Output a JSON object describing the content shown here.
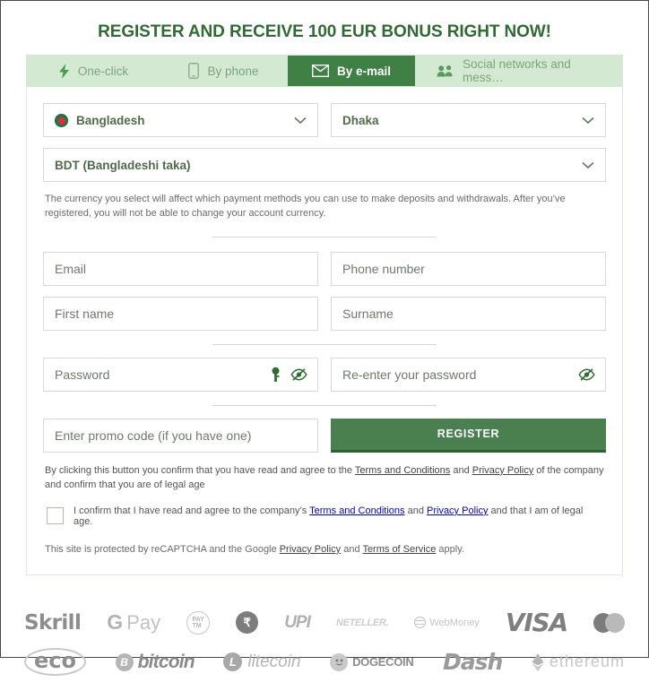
{
  "page": {
    "title": "REGISTER AND RECEIVE 100 EUR BONUS RIGHT NOW!"
  },
  "tabs": [
    {
      "label": "One-click",
      "icon": "lightning-bolt-icon",
      "active": false
    },
    {
      "label": "By phone",
      "icon": "mobile-phone-icon",
      "active": false
    },
    {
      "label": "By e-mail",
      "icon": "envelope-icon",
      "active": true
    },
    {
      "label": "Social networks and mess…",
      "icon": "people-group-icon",
      "active": false
    }
  ],
  "form": {
    "country": {
      "value": "Bangladesh",
      "flag": "bangladesh-flag-icon"
    },
    "city": {
      "value": "Dhaka"
    },
    "currency": {
      "value": "BDT (Bangladeshi taka)"
    },
    "currency_note": "The currency you select will affect which payment methods you can use to make deposits and withdrawals. After you’ve registered, you will not be able to change your account currency.",
    "email": {
      "placeholder": "Email",
      "value": ""
    },
    "phone": {
      "placeholder": "Phone number",
      "value": ""
    },
    "first_name": {
      "placeholder": "First name",
      "value": ""
    },
    "surname": {
      "placeholder": "Surname",
      "value": ""
    },
    "password": {
      "placeholder": "Password",
      "value": ""
    },
    "password_repeat": {
      "placeholder": "Re-enter your password",
      "value": ""
    },
    "promo": {
      "placeholder": "Enter promo code (if you have one)",
      "value": ""
    },
    "register_label": "REGISTER"
  },
  "legal": {
    "terms_prefix": "By clicking this button you confirm that you have read and agree to the ",
    "terms_link": "Terms and Conditions",
    "terms_mid": " and ",
    "privacy_link": "Privacy Policy",
    "terms_suffix": " of the company and confirm that you are of legal age",
    "confirm_prefix": "I confirm that I have read and agree to the company’s ",
    "confirm_link1": "Terms and Conditions",
    "confirm_mid": " and ",
    "confirm_link2": "Privacy Policy",
    "confirm_suffix": " and that I am of legal age.",
    "recaptcha_prefix": "This site is protected by reCAPTCHA and the Google ",
    "recaptcha_link1": "Privacy Policy",
    "recaptcha_mid": " and ",
    "recaptcha_link2": "Terms of Service",
    "recaptcha_suffix": " apply."
  },
  "payments": {
    "row1": [
      {
        "name": "skrill",
        "label": "Skrill"
      },
      {
        "name": "google-pay",
        "label": "G Pay",
        "g": "G",
        "pay": "Pay"
      },
      {
        "name": "paytm",
        "label": "Paytm"
      },
      {
        "name": "phonepe",
        "label": "₹"
      },
      {
        "name": "upi",
        "label": "UPI"
      },
      {
        "name": "neteller",
        "label": "NETELLER."
      },
      {
        "name": "webmoney",
        "label": "WebMoney"
      },
      {
        "name": "visa",
        "label": "VISA"
      },
      {
        "name": "mastercard",
        "label": "Mastercard"
      }
    ],
    "row2": [
      {
        "name": "ecopayz",
        "label": "eco"
      },
      {
        "name": "bitcoin",
        "label": "bitcoin",
        "sym": "B"
      },
      {
        "name": "litecoin",
        "label": "litecoin",
        "sym": "L"
      },
      {
        "name": "dogecoin",
        "label": "DOGECOIN"
      },
      {
        "name": "dash",
        "label": "Dash"
      },
      {
        "name": "ethereum",
        "label": "ethereum"
      }
    ]
  },
  "colors": {
    "brand_green": "#3f8045",
    "title_green": "#2f6b33",
    "tab_bar_bg": "#d4e9d2",
    "button_green": "#4a8050"
  }
}
